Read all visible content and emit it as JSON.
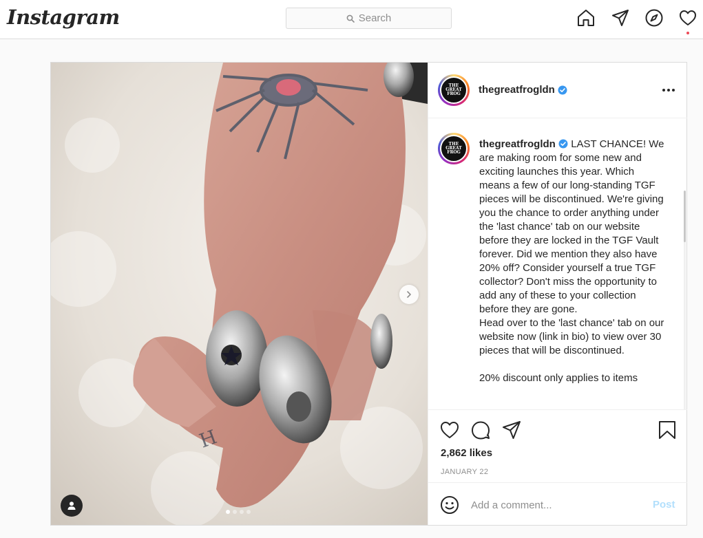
{
  "nav": {
    "logo": "Instagram",
    "search_placeholder": "Search",
    "icons": [
      "home-icon",
      "direct-send-icon",
      "explore-compass-icon",
      "activity-heart-icon"
    ]
  },
  "post": {
    "author": {
      "username": "thegreatfrogldn",
      "verified": true,
      "avatar_text": "THE GREAT FROG"
    },
    "carousel": {
      "slide_count": 4,
      "current_slide": 1
    },
    "caption": {
      "username": "thegreatfrogldn",
      "paragraph_1": "LAST CHANCE! We are making room for some new and exciting launches this year. Which means a few of our long-standing TGF pieces will be discontinued. We're giving you the chance to order anything under the 'last chance' tab on our website before they are locked in the TGF Vault forever. Did we mention they also have 20% off? Consider yourself a true TGF collector? Don't miss the opportunity to add any of these to your collection before they are gone.",
      "paragraph_2": "Head over to the 'last chance' tab on our website now (link in bio) to view over 30 pieces that will be discontinued.",
      "paragraph_3": "20% discount only applies to items"
    },
    "likes": "2,862 likes",
    "date": "JANUARY 22",
    "comment": {
      "placeholder": "Add a comment...",
      "post_label": "Post"
    }
  },
  "colors": {
    "text": "#262626",
    "muted": "#8e8e8e",
    "border": "#dbdbdb",
    "verified": "#3897f0",
    "post_button_disabled": "#b2dffc",
    "notification_dot": "#ed4956"
  }
}
